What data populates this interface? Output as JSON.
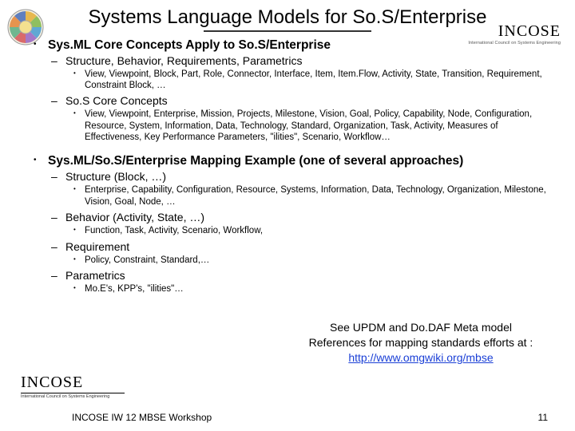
{
  "title": "Systems Language Models for So.S/Enterprise",
  "logo": {
    "brand": "INCOSE",
    "tagline": "International Council on Systems Engineering"
  },
  "sections": [
    {
      "heading": "Sys.ML Core Concepts Apply to So.S/Enterprise",
      "items": [
        {
          "label": "Structure, Behavior, Requirements, Parametrics",
          "sub": [
            "View, Viewpoint, Block, Part, Role, Connector, Interface, Item, Item.Flow, Activity, State, Transition, Requirement, Constraint Block, …"
          ]
        },
        {
          "label": "So.S Core Concepts",
          "sub": [
            "View, Viewpoint, Enterprise, Mission, Projects, Milestone, Vision, Goal, Policy, Capability, Node, Configuration, Resource, System, Information, Data, Technology, Standard, Organization, Task, Activity, Measures of Effectiveness, Key Performance Parameters, \"ilities\", Scenario, Workflow…"
          ]
        }
      ]
    },
    {
      "heading": "Sys.ML/So.S/Enterprise Mapping Example (one of several approaches)",
      "items": [
        {
          "label": "Structure (Block, …)",
          "sub": [
            "Enterprise, Capability, Configuration, Resource, Systems, Information, Data, Technology, Organization, Milestone, Vision, Goal, Node, …"
          ]
        },
        {
          "label": "Behavior (Activity, State, …)",
          "sub": [
            "Function, Task, Activity, Scenario, Workflow,"
          ]
        },
        {
          "label": "Requirement",
          "sub": [
            "Policy, Constraint, Standard,…"
          ]
        },
        {
          "label": "Parametrics",
          "sub": [
            "Mo.E's,  KPP's, \"ilities\"…"
          ]
        }
      ]
    }
  ],
  "aside": {
    "line1": "See UPDM and Do.DAF Meta model",
    "line2": "References for mapping standards efforts at : ",
    "link_text": "http://www.omgwiki.org/mbse"
  },
  "footer": {
    "left": "INCOSE IW 12 MBSE Workshop",
    "right": "11"
  }
}
